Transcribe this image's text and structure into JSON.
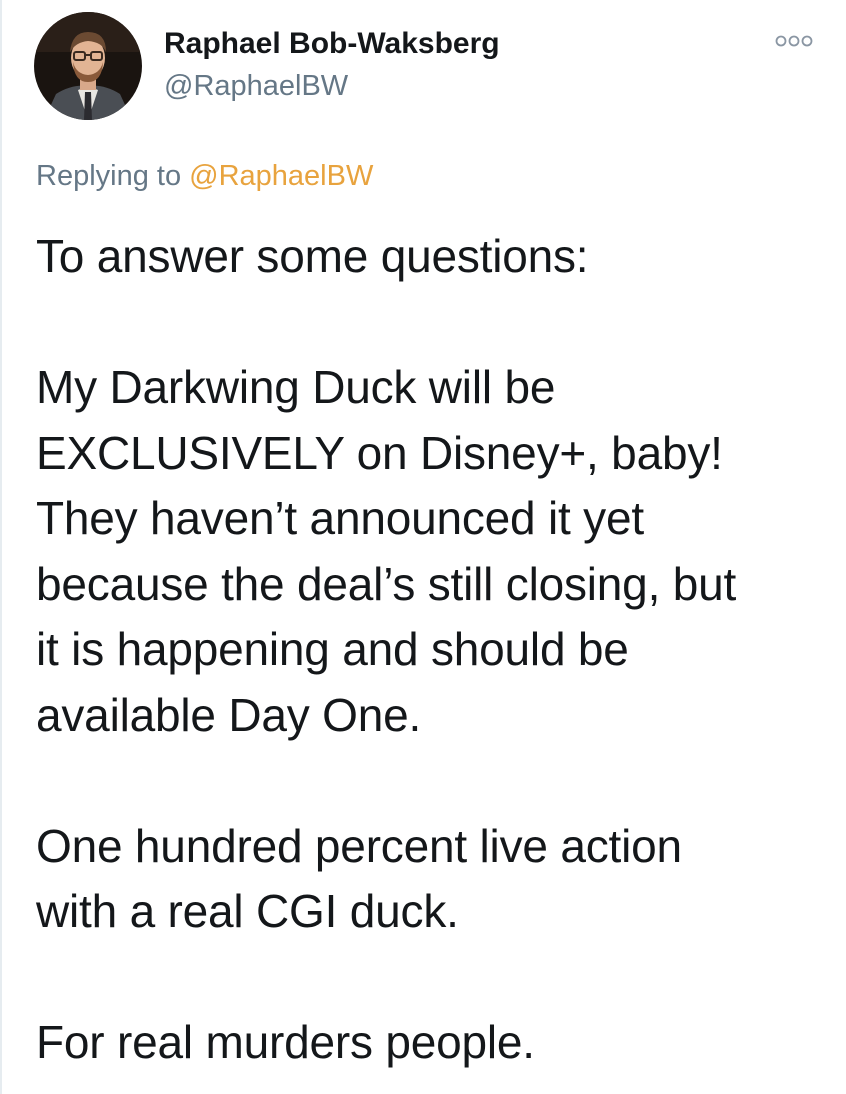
{
  "author": {
    "name": "Raphael Bob-Waksberg",
    "handle": "@RaphaelBW"
  },
  "reply": {
    "prefix": "Replying to ",
    "handle": "@RaphaelBW"
  },
  "more_icon": "more-options-icon",
  "tweet": {
    "lines": [
      "To answer some questions:",
      "",
      "My Darkwing Duck will be",
      "EXCLUSIVELY on Disney+, baby!",
      "They haven’t announced it yet",
      "because the deal’s still closing, but",
      "it is happening and should be",
      "available Day One.",
      "",
      "One hundred percent live action",
      "with a real CGI duck.",
      "",
      "For real murders people."
    ]
  },
  "colors": {
    "text": "#14171a",
    "muted": "#657786",
    "link": "#e8a33e"
  }
}
